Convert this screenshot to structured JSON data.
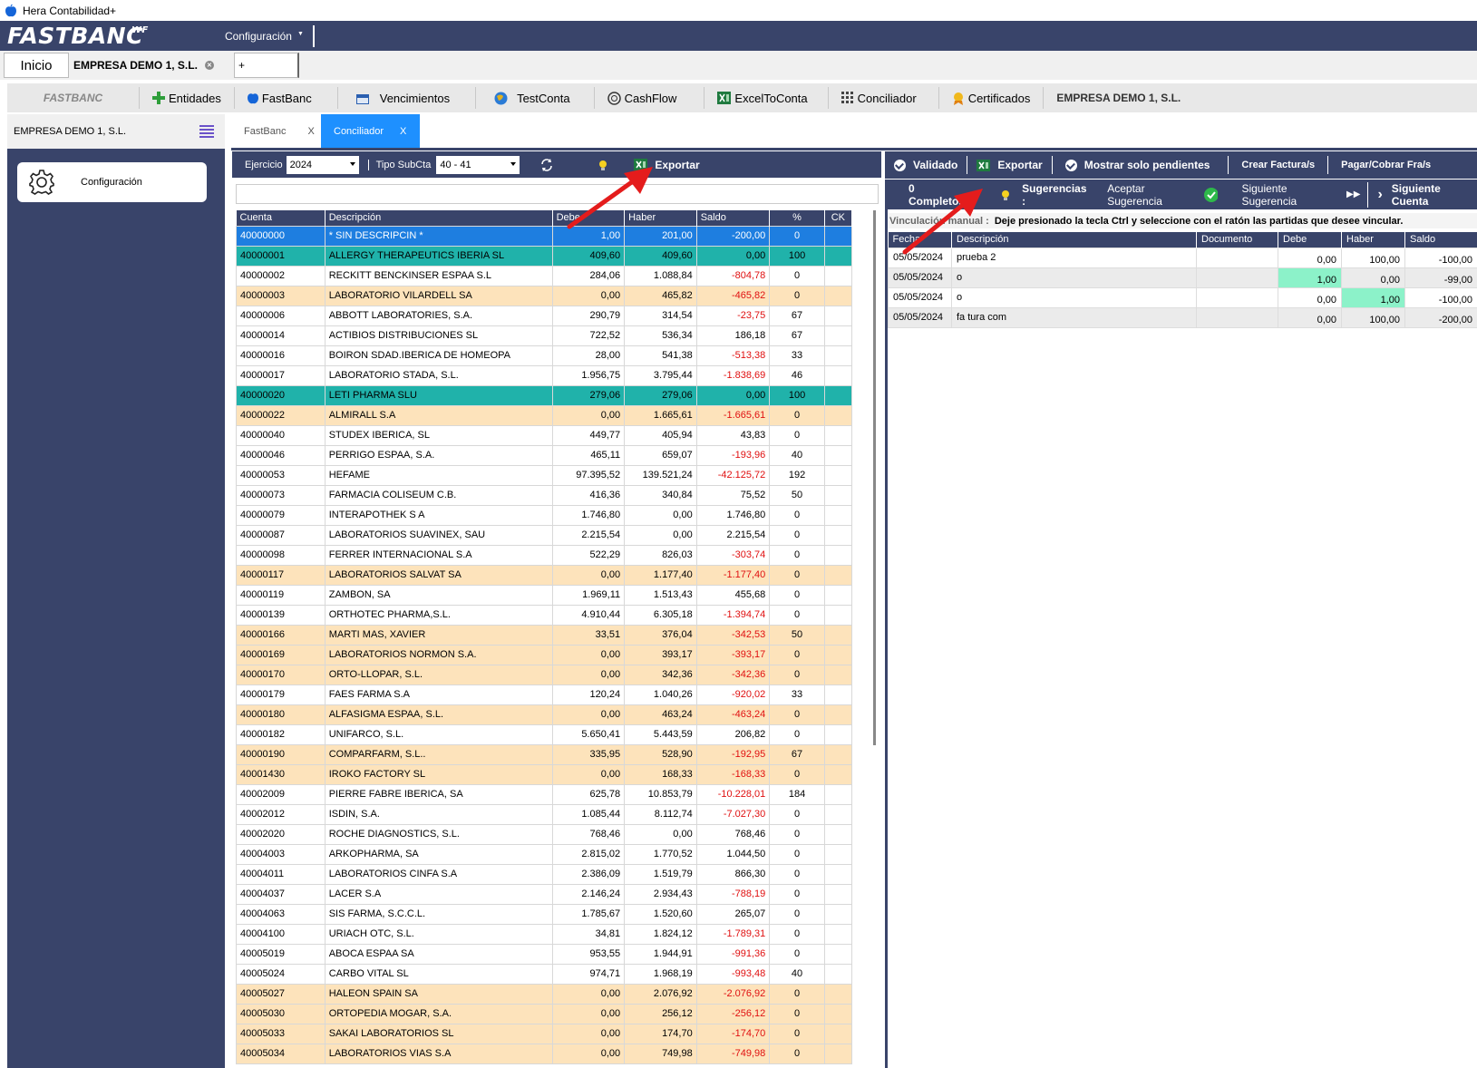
{
  "window": {
    "title": "Hera Contabilidad+"
  },
  "brand": {
    "name": "FASTBANC",
    "suffix": "WF",
    "config_menu": "Configuración"
  },
  "doc_tabs": {
    "home": "Inicio",
    "company": "EMPRESA DEMO 1, S.L.",
    "add": "+"
  },
  "nav": {
    "logo": "FASTBANC",
    "items": [
      {
        "label": "Entidades",
        "icon": "plus-icon"
      },
      {
        "label": "FastBanc",
        "icon": "apple-icon"
      },
      {
        "label": "Vencimientos",
        "icon": "calendar-icon"
      },
      {
        "label": "TestConta",
        "icon": "globe-icon"
      },
      {
        "label": "CashFlow",
        "icon": "cash-icon"
      },
      {
        "label": "ExcelToConta",
        "icon": "excel-icon"
      },
      {
        "label": "Conciliador",
        "icon": "grid-icon"
      },
      {
        "label": "Certificados",
        "icon": "certificate-icon"
      }
    ],
    "company": "EMPRESA DEMO 1, S.L."
  },
  "sidebar": {
    "company": "EMPRESA DEMO 1, S.L.",
    "config_button": "Configuración"
  },
  "inner_tabs": [
    {
      "label": "FastBanc",
      "close": "X"
    },
    {
      "label": "Conciliador",
      "close": "X"
    }
  ],
  "left_toolbar": {
    "ejercicio_label": "Ejercicio",
    "ejercicio_value": "2024",
    "tipo_label": "Tipo SubCta",
    "tipo_value": "40 - 41",
    "export_label": "Exportar"
  },
  "accounts_table": {
    "headers": [
      "Cuenta",
      "Descripción",
      "Debe",
      "Haber",
      "Saldo",
      "%",
      "CK"
    ],
    "rows": [
      {
        "cuenta": "40000000",
        "desc": "* SIN DESCRIPCIN *",
        "debe": "1,00",
        "haber": "201,00",
        "saldo": "-200,00",
        "pct": "0",
        "style": "sel1"
      },
      {
        "cuenta": "40000001",
        "desc": "ALLERGY THERAPEUTICS IBERIA SL",
        "debe": "409,60",
        "haber": "409,60",
        "saldo": "0,00",
        "pct": "100",
        "style": "sel2"
      },
      {
        "cuenta": "40000002",
        "desc": "RECKITT BENCKINSER ESPAA S.L",
        "debe": "284,06",
        "haber": "1.088,84",
        "saldo": "-804,78",
        "pct": "0",
        "style": ""
      },
      {
        "cuenta": "40000003",
        "desc": "LABORATORIO VILARDELL SA",
        "debe": "0,00",
        "haber": "465,82",
        "saldo": "-465,82",
        "pct": "0",
        "style": "orange"
      },
      {
        "cuenta": "40000006",
        "desc": "ABBOTT LABORATORIES, S.A.",
        "debe": "290,79",
        "haber": "314,54",
        "saldo": "-23,75",
        "pct": "67",
        "style": ""
      },
      {
        "cuenta": "40000014",
        "desc": "ACTIBIOS DISTRIBUCIONES SL",
        "debe": "722,52",
        "haber": "536,34",
        "saldo": "186,18",
        "pct": "67",
        "style": ""
      },
      {
        "cuenta": "40000016",
        "desc": "BOIRON SDAD.IBERICA DE HOMEOPA",
        "debe": "28,00",
        "haber": "541,38",
        "saldo": "-513,38",
        "pct": "33",
        "style": ""
      },
      {
        "cuenta": "40000017",
        "desc": "LABORATORIO STADA, S.L.",
        "debe": "1.956,75",
        "haber": "3.795,44",
        "saldo": "-1.838,69",
        "pct": "46",
        "style": ""
      },
      {
        "cuenta": "40000020",
        "desc": "LETI PHARMA SLU",
        "debe": "279,06",
        "haber": "279,06",
        "saldo": "0,00",
        "pct": "100",
        "style": "sel2"
      },
      {
        "cuenta": "40000022",
        "desc": "ALMIRALL S.A",
        "debe": "0,00",
        "haber": "1.665,61",
        "saldo": "-1.665,61",
        "pct": "0",
        "style": "orange"
      },
      {
        "cuenta": "40000040",
        "desc": "STUDEX IBERICA, SL",
        "debe": "449,77",
        "haber": "405,94",
        "saldo": "43,83",
        "pct": "0",
        "style": ""
      },
      {
        "cuenta": "40000046",
        "desc": "PERRIGO ESPAA, S.A.",
        "debe": "465,11",
        "haber": "659,07",
        "saldo": "-193,96",
        "pct": "40",
        "style": ""
      },
      {
        "cuenta": "40000053",
        "desc": "HEFAME",
        "debe": "97.395,52",
        "haber": "139.521,24",
        "saldo": "-42.125,72",
        "pct": "192",
        "style": ""
      },
      {
        "cuenta": "40000073",
        "desc": "FARMACIA COLISEUM C.B.",
        "debe": "416,36",
        "haber": "340,84",
        "saldo": "75,52",
        "pct": "50",
        "style": ""
      },
      {
        "cuenta": "40000079",
        "desc": "INTERAPOTHEK  S A",
        "debe": "1.746,80",
        "haber": "0,00",
        "saldo": "1.746,80",
        "pct": "0",
        "style": ""
      },
      {
        "cuenta": "40000087",
        "desc": "LABORATORIOS SUAVINEX, SAU",
        "debe": "2.215,54",
        "haber": "0,00",
        "saldo": "2.215,54",
        "pct": "0",
        "style": ""
      },
      {
        "cuenta": "40000098",
        "desc": "FERRER INTERNACIONAL S.A",
        "debe": "522,29",
        "haber": "826,03",
        "saldo": "-303,74",
        "pct": "0",
        "style": ""
      },
      {
        "cuenta": "40000117",
        "desc": "LABORATORIOS SALVAT SA",
        "debe": "0,00",
        "haber": "1.177,40",
        "saldo": "-1.177,40",
        "pct": "0",
        "style": "orange"
      },
      {
        "cuenta": "40000119",
        "desc": "ZAMBON, SA",
        "debe": "1.969,11",
        "haber": "1.513,43",
        "saldo": "455,68",
        "pct": "0",
        "style": ""
      },
      {
        "cuenta": "40000139",
        "desc": "ORTHOTEC PHARMA,S.L.",
        "debe": "4.910,44",
        "haber": "6.305,18",
        "saldo": "-1.394,74",
        "pct": "0",
        "style": ""
      },
      {
        "cuenta": "40000166",
        "desc": "MARTI MAS, XAVIER",
        "debe": "33,51",
        "haber": "376,04",
        "saldo": "-342,53",
        "pct": "50",
        "style": "orange"
      },
      {
        "cuenta": "40000169",
        "desc": "LABORATORIOS NORMON S.A.",
        "debe": "0,00",
        "haber": "393,17",
        "saldo": "-393,17",
        "pct": "0",
        "style": "orange"
      },
      {
        "cuenta": "40000170",
        "desc": "ORTO-LLOPAR, S.L.",
        "debe": "0,00",
        "haber": "342,36",
        "saldo": "-342,36",
        "pct": "0",
        "style": "orange"
      },
      {
        "cuenta": "40000179",
        "desc": "FAES FARMA S.A",
        "debe": "120,24",
        "haber": "1.040,26",
        "saldo": "-920,02",
        "pct": "33",
        "style": ""
      },
      {
        "cuenta": "40000180",
        "desc": "ALFASIGMA ESPAA, S.L.",
        "debe": "0,00",
        "haber": "463,24",
        "saldo": "-463,24",
        "pct": "0",
        "style": "orange"
      },
      {
        "cuenta": "40000182",
        "desc": "UNIFARCO, S.L.",
        "debe": "5.650,41",
        "haber": "5.443,59",
        "saldo": "206,82",
        "pct": "0",
        "style": ""
      },
      {
        "cuenta": "40000190",
        "desc": "COMPARFARM, S.L..",
        "debe": "335,95",
        "haber": "528,90",
        "saldo": "-192,95",
        "pct": "67",
        "style": "orange"
      },
      {
        "cuenta": "40001430",
        "desc": "IROKO FACTORY SL",
        "debe": "0,00",
        "haber": "168,33",
        "saldo": "-168,33",
        "pct": "0",
        "style": "orange"
      },
      {
        "cuenta": "40002009",
        "desc": "PIERRE FABRE IBERICA, SA",
        "debe": "625,78",
        "haber": "10.853,79",
        "saldo": "-10.228,01",
        "pct": "184",
        "style": ""
      },
      {
        "cuenta": "40002012",
        "desc": "ISDIN, S.A.",
        "debe": "1.085,44",
        "haber": "8.112,74",
        "saldo": "-7.027,30",
        "pct": "0",
        "style": ""
      },
      {
        "cuenta": "40002020",
        "desc": "ROCHE DIAGNOSTICS, S.L.",
        "debe": "768,46",
        "haber": "0,00",
        "saldo": "768,46",
        "pct": "0",
        "style": ""
      },
      {
        "cuenta": "40004003",
        "desc": "ARKOPHARMA, SA",
        "debe": "2.815,02",
        "haber": "1.770,52",
        "saldo": "1.044,50",
        "pct": "0",
        "style": ""
      },
      {
        "cuenta": "40004011",
        "desc": "LABORATORIOS CINFA S.A",
        "debe": "2.386,09",
        "haber": "1.519,79",
        "saldo": "866,30",
        "pct": "0",
        "style": ""
      },
      {
        "cuenta": "40004037",
        "desc": "LACER S.A",
        "debe": "2.146,24",
        "haber": "2.934,43",
        "saldo": "-788,19",
        "pct": "0",
        "style": ""
      },
      {
        "cuenta": "40004063",
        "desc": "SIS FARMA, S.C.C.L.",
        "debe": "1.785,67",
        "haber": "1.520,60",
        "saldo": "265,07",
        "pct": "0",
        "style": ""
      },
      {
        "cuenta": "40004100",
        "desc": "URIACH OTC, S.L.",
        "debe": "34,81",
        "haber": "1.824,12",
        "saldo": "-1.789,31",
        "pct": "0",
        "style": ""
      },
      {
        "cuenta": "40005019",
        "desc": "ABOCA ESPAA SA",
        "debe": "953,55",
        "haber": "1.944,91",
        "saldo": "-991,36",
        "pct": "0",
        "style": ""
      },
      {
        "cuenta": "40005024",
        "desc": "CARBO VITAL SL",
        "debe": "974,71",
        "haber": "1.968,19",
        "saldo": "-993,48",
        "pct": "40",
        "style": ""
      },
      {
        "cuenta": "40005027",
        "desc": "HALEON SPAIN SA",
        "debe": "0,00",
        "haber": "2.076,92",
        "saldo": "-2.076,92",
        "pct": "0",
        "style": "orange"
      },
      {
        "cuenta": "40005030",
        "desc": "ORTOPEDIA MOGAR, S.A.",
        "debe": "0,00",
        "haber": "256,12",
        "saldo": "-256,12",
        "pct": "0",
        "style": "orange"
      },
      {
        "cuenta": "40005033",
        "desc": "SAKAI LABORATORIOS SL",
        "debe": "0,00",
        "haber": "174,70",
        "saldo": "-174,70",
        "pct": "0",
        "style": "orange"
      },
      {
        "cuenta": "40005034",
        "desc": "LABORATORIOS VIAS  S.A",
        "debe": "0,00",
        "haber": "749,98",
        "saldo": "-749,98",
        "pct": "0",
        "style": "orange"
      }
    ]
  },
  "right_toolbar": {
    "validado": "Validado",
    "exportar": "Exportar",
    "pendientes": "Mostrar solo pendientes",
    "crear": "Crear Factura/s",
    "pagar": "Pagar/Cobrar Fra/s",
    "completos": "0 Completos",
    "sugerencias": "Sugerencias :",
    "aceptar": "Aceptar Sugerencia",
    "siguiente_sug": "Siguiente Sugerencia",
    "siguiente_cuenta": "Siguiente Cuenta"
  },
  "manual_link": {
    "label": "Vinculación manual :",
    "hint": "Deje presionado la tecla Ctrl y seleccione con el ratón las partidas que desee vincular."
  },
  "entries_table": {
    "headers": [
      "Fecha",
      "Descripción",
      "Documento",
      "Debe",
      "Haber",
      "Saldo"
    ],
    "rows": [
      {
        "fecha": "05/05/2024",
        "desc": "prueba 2",
        "doc": "",
        "debe": "0,00",
        "haber": "100,00",
        "saldo": "-100,00",
        "g": false,
        "hl": ""
      },
      {
        "fecha": "05/05/2024",
        "desc": "o",
        "doc": "",
        "debe": "1,00",
        "haber": "0,00",
        "saldo": "-99,00",
        "g": true,
        "hl": "debe"
      },
      {
        "fecha": "05/05/2024",
        "desc": "o",
        "doc": "",
        "debe": "0,00",
        "haber": "1,00",
        "saldo": "-100,00",
        "g": false,
        "hl": "haber"
      },
      {
        "fecha": "05/05/2024",
        "desc": "fa tura com",
        "doc": "",
        "debe": "0,00",
        "haber": "100,00",
        "saldo": "-200,00",
        "g": true,
        "hl": ""
      }
    ]
  },
  "colors": {
    "navy": "#39446a",
    "selected_blue": "#1e7ee0",
    "teal": "#20b2aa",
    "orange_row": "#fde3bb",
    "negative": "#e01010",
    "highlight_green": "#8cf2c9",
    "arrow_red": "#e41c1c"
  }
}
